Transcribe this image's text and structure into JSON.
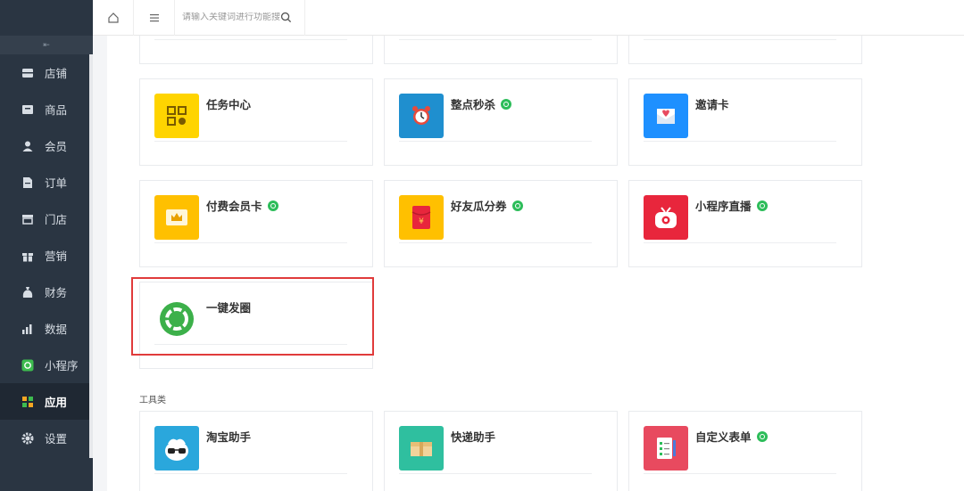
{
  "sidebar": {
    "collapse_glyph": "⇤",
    "items": [
      {
        "label": "店铺",
        "icon": "store-icon"
      },
      {
        "label": "商品",
        "icon": "goods-icon"
      },
      {
        "label": "会员",
        "icon": "member-icon"
      },
      {
        "label": "订单",
        "icon": "order-icon"
      },
      {
        "label": "门店",
        "icon": "shop-icon"
      },
      {
        "label": "营销",
        "icon": "gift-icon"
      },
      {
        "label": "财务",
        "icon": "money-bag-icon"
      },
      {
        "label": "数据",
        "icon": "chart-icon"
      },
      {
        "label": "小程序",
        "icon": "miniprogram-icon"
      },
      {
        "label": "应用",
        "icon": "apps-icon",
        "active": true
      },
      {
        "label": "设置",
        "icon": "gear-icon"
      }
    ]
  },
  "topbar": {
    "search_placeholder": "请输入关键词进行功能搜"
  },
  "cards": {
    "task_center": {
      "title": "任务中心",
      "color": "#ffd400"
    },
    "flash_sale": {
      "title": "整点秒杀",
      "color": "#1f8fcf"
    },
    "invite_card": {
      "title": "邀请卡",
      "color": "#1e90ff"
    },
    "paid_member": {
      "title": "付费会员卡",
      "color": "#ffc000"
    },
    "friend_coupon": {
      "title": "好友瓜分券",
      "color": "#ffc000"
    },
    "live": {
      "title": "小程序直播",
      "color": "#e8263c"
    },
    "moments": {
      "title": "一键发圈",
      "color": "#3cb04a"
    },
    "taobao": {
      "title": "淘宝助手",
      "color": "#2aa7dc"
    },
    "express": {
      "title": "快递助手",
      "color": "#2fbf9f"
    },
    "form": {
      "title": "自定义表单",
      "color": "#e84a5f"
    }
  },
  "sections": {
    "tools": "工具类"
  },
  "colors": {
    "sidebar_bg": "#2a3542",
    "highlight": "#e03b3b",
    "badge_green": "#2dbd5a"
  }
}
